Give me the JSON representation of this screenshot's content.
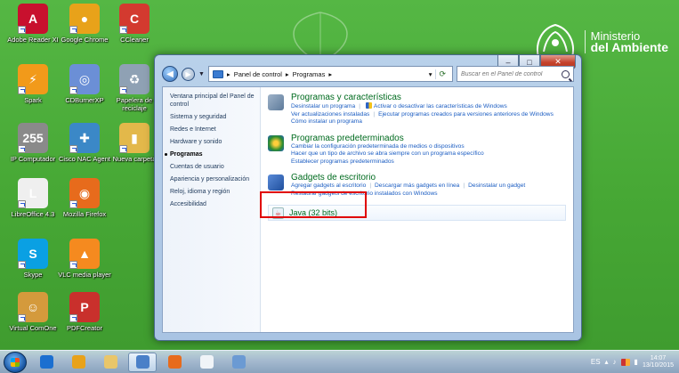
{
  "desktop": {
    "brand": {
      "line1": "Ministerio",
      "line2": "del Ambiente"
    },
    "icons": [
      {
        "label": "Adobe Reader XI",
        "icon": "adobe-reader-icon",
        "color": "#c8102e",
        "glyph": "A"
      },
      {
        "label": "Google Chrome",
        "icon": "chrome-icon",
        "color": "#e8a21a",
        "glyph": "●"
      },
      {
        "label": "CCleaner",
        "icon": "ccleaner-icon",
        "color": "#d33a2f",
        "glyph": "C"
      },
      {
        "label": "Spark",
        "icon": "spark-icon",
        "color": "#f29a1a",
        "glyph": "⚡"
      },
      {
        "label": "CDBurnerXP",
        "icon": "cdburnerxp-icon",
        "color": "#6b8fd6",
        "glyph": "◎"
      },
      {
        "label": "Papelera de reciclaje",
        "icon": "recycle-bin-icon",
        "color": "#8fa1b4",
        "glyph": "♻"
      },
      {
        "label": "IP Computador",
        "icon": "ip-computer-icon",
        "color": "#8a8a8a",
        "glyph": "255"
      },
      {
        "label": "Cisco NAC Agent",
        "icon": "cisco-nac-agent-icon",
        "color": "#3b88c7",
        "glyph": "✚"
      },
      {
        "label": "Nueva carpeta",
        "icon": "folder-icon",
        "color": "#e3b84a",
        "glyph": "▮"
      },
      {
        "label": "LibreOffice 4.3",
        "icon": "libreoffice-icon",
        "color": "#efefef",
        "glyph": "L"
      },
      {
        "label": "Mozilla Firefox",
        "icon": "firefox-icon",
        "color": "#e76b1c",
        "glyph": "◉"
      },
      {
        "label": "Skype",
        "icon": "skype-icon",
        "color": "#0aa0e3",
        "glyph": "S"
      },
      {
        "label": "VLC media player",
        "icon": "vlc-icon",
        "color": "#f58a1f",
        "glyph": "▲"
      },
      {
        "label": "Virtual ComOne",
        "icon": "virtual-comone-icon",
        "color": "#d49a3c",
        "glyph": "☺"
      },
      {
        "label": "PDFCreator",
        "icon": "pdfcreator-icon",
        "color": "#c9302c",
        "glyph": "P"
      }
    ]
  },
  "window": {
    "address": {
      "seg1": "Panel de control",
      "seg2": "Programas",
      "arrow": "▸"
    },
    "search_placeholder": "Buscar en el Panel de control",
    "controls": {
      "minimize": "–",
      "maximize": "□",
      "close": "✕"
    },
    "leftnav": [
      {
        "label": "Ventana principal del Panel de control",
        "active": false
      },
      {
        "label": "Sistema y seguridad",
        "active": false
      },
      {
        "label": "Redes e Internet",
        "active": false
      },
      {
        "label": "Hardware y sonido",
        "active": false
      },
      {
        "label": "Programas",
        "active": true
      },
      {
        "label": "Cuentas de usuario",
        "active": false
      },
      {
        "label": "Apariencia y personalización",
        "active": false
      },
      {
        "label": "Reloj, idioma y región",
        "active": false
      },
      {
        "label": "Accesibilidad",
        "active": false
      }
    ],
    "categories": [
      {
        "title": "Programas y características",
        "icon": "programs-features-icon",
        "links": [
          [
            "Desinstalar un programa",
            "Activar o desactivar las características de Windows"
          ],
          [
            "Ver actualizaciones instaladas",
            "Ejecutar programas creados para versiones anteriores de Windows"
          ],
          [
            "Cómo instalar un programa"
          ]
        ]
      },
      {
        "title": "Programas predeterminados",
        "icon": "default-programs-icon",
        "links": [
          [
            "Cambiar la configuración predeterminada de medios o dispositivos"
          ],
          [
            "Hacer que un tipo de archivo se abra siempre con un programa específico"
          ],
          [
            "Establecer programas predeterminados"
          ]
        ]
      },
      {
        "title": "Gadgets de escritorio",
        "icon": "desktop-gadgets-icon",
        "links": [
          [
            "Agregar gadgets al escritorio",
            "Descargar más gadgets en línea",
            "Desinstalar un gadget"
          ],
          [
            "Restaurar gadgets de escritorio instalados con Windows"
          ]
        ]
      }
    ],
    "java": {
      "label": "Java (32 bits)"
    }
  },
  "taskbar": {
    "apps": [
      "internet-explorer-icon",
      "chrome-icon",
      "explorer-folder-icon",
      "control-panel-icon",
      "firefox-icon",
      "document-icon",
      "remote-desktop-icon"
    ],
    "app_colors": [
      "#1b6fd0",
      "#e8a21a",
      "#e9c66a",
      "#4a80c8",
      "#e76b1c",
      "#f0f4f8",
      "#6b9ad3"
    ],
    "tray": {
      "lang": "ES",
      "time": "14:07",
      "date": "13/10/2015"
    }
  }
}
